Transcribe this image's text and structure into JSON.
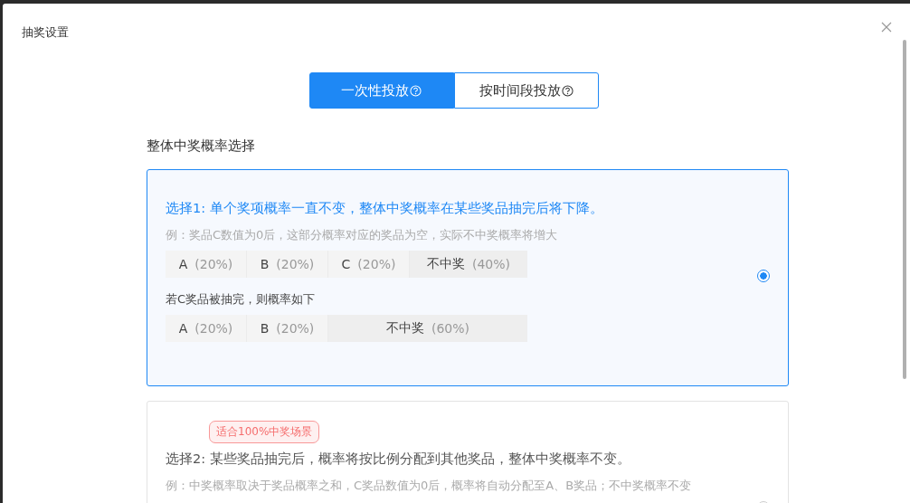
{
  "dialog": {
    "title": "抽奖设置"
  },
  "tabs": [
    {
      "label": "一次性投放",
      "selected": true
    },
    {
      "label": "按时间段投放",
      "selected": false
    }
  ],
  "section_label": "整体中奖概率选择",
  "options": [
    {
      "selected": true,
      "blocks": [
        {
          "kind": "title",
          "text": "选择1: 单个奖项概率一直不变，整体中奖概率在某些奖品抽完后将下降。"
        },
        {
          "kind": "example",
          "text": "例：奖品C数值为0后，这部分概率对应的奖品为空，实际不中奖概率将增大"
        },
        {
          "kind": "segments",
          "segments": [
            {
              "kind": "prize",
              "label": "A",
              "percent": "(20%)"
            },
            {
              "kind": "prize",
              "label": "B",
              "percent": "(20%)"
            },
            {
              "kind": "prize",
              "label": "C",
              "percent": "(20%)"
            },
            {
              "kind": "none",
              "label": "不中奖",
              "percent": "(40%)"
            }
          ]
        },
        {
          "kind": "note",
          "text": "若C奖品被抽完，则概率如下"
        },
        {
          "kind": "segments",
          "segments": [
            {
              "kind": "prize",
              "label": "A",
              "percent": "(20%)"
            },
            {
              "kind": "prize",
              "label": "B",
              "percent": "(20%)"
            },
            {
              "kind": "none",
              "label": "不中奖",
              "percent": "(60%)"
            }
          ]
        }
      ]
    },
    {
      "selected": false,
      "blocks": [
        {
          "kind": "badge",
          "text": "适合100%中奖场景"
        },
        {
          "kind": "title",
          "text": "选择2: 某些奖品抽完后，概率将按比例分配到其他奖品，整体中奖概率不变。"
        },
        {
          "kind": "example",
          "text": "例：中奖概率取决于奖品概率之和，C奖品数值为0后，概率将自动分配至A、B奖品；不中奖概率不变"
        }
      ]
    }
  ]
}
